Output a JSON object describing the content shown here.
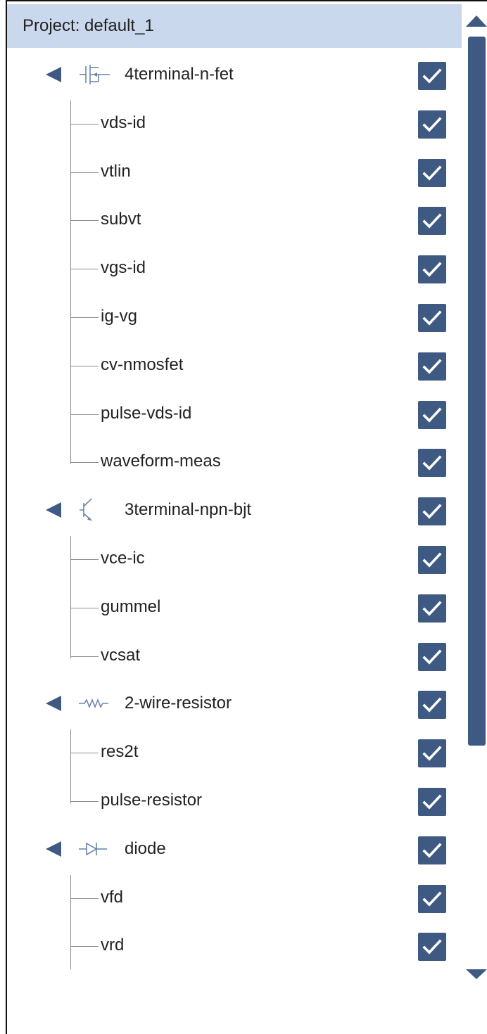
{
  "project": {
    "title": "Project: default_1"
  },
  "tree": [
    {
      "label": "4terminal-n-fet",
      "icon": "nfet-icon",
      "checked": true,
      "children": [
        {
          "label": "vds-id",
          "checked": true
        },
        {
          "label": "vtlin",
          "checked": true
        },
        {
          "label": "subvt",
          "checked": true
        },
        {
          "label": "vgs-id",
          "checked": true
        },
        {
          "label": "ig-vg",
          "checked": true
        },
        {
          "label": "cv-nmosfet",
          "checked": true
        },
        {
          "label": "pulse-vds-id",
          "checked": true
        },
        {
          "label": "waveform-meas",
          "checked": true
        }
      ]
    },
    {
      "label": "3terminal-npn-bjt",
      "icon": "npn-bjt-icon",
      "checked": true,
      "children": [
        {
          "label": "vce-ic",
          "checked": true
        },
        {
          "label": "gummel",
          "checked": true
        },
        {
          "label": "vcsat",
          "checked": true
        }
      ]
    },
    {
      "label": "2-wire-resistor",
      "icon": "resistor-icon",
      "checked": true,
      "children": [
        {
          "label": "res2t",
          "checked": true
        },
        {
          "label": "pulse-resistor",
          "checked": true
        }
      ]
    },
    {
      "label": "diode",
      "icon": "diode-icon",
      "checked": true,
      "children": [
        {
          "label": "vfd",
          "checked": true
        },
        {
          "label": "vrd",
          "checked": true
        }
      ]
    }
  ],
  "colors": {
    "accent": "#3f5a82",
    "header_bg": "#c9d8ec",
    "tree_line": "#8c8c8c"
  }
}
